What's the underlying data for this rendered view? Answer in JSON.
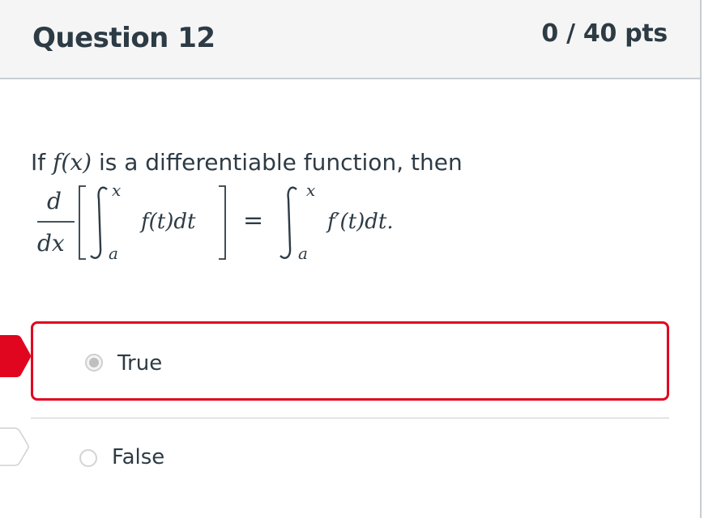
{
  "question": {
    "title": "Question 12",
    "points": "0 / 40 pts",
    "text_prefix": "If",
    "text_fx": "f(x)",
    "text_suffix": " is a differentiable function, then",
    "formula": {
      "d": "d",
      "dx": "dx",
      "upper_left": "x",
      "lower_left": "a",
      "integrand_left": "f(t)dt",
      "equals": "=",
      "upper_right": "x",
      "lower_right": "a",
      "integrand_right": "f′(t)dt."
    }
  },
  "answers": [
    {
      "label": "True",
      "selected": true,
      "marked": "incorrect"
    },
    {
      "label": "False",
      "selected": false,
      "marked": "correct-answer"
    }
  ],
  "colors": {
    "wrong_marker": "#e0061f",
    "selected_border": "#e0061f",
    "text": "#2d3b45",
    "header_bg": "#f5f5f5"
  },
  "icons": {
    "wrong_marker": "arrow-marker-red",
    "correct_marker": "arrow-marker-outline"
  }
}
